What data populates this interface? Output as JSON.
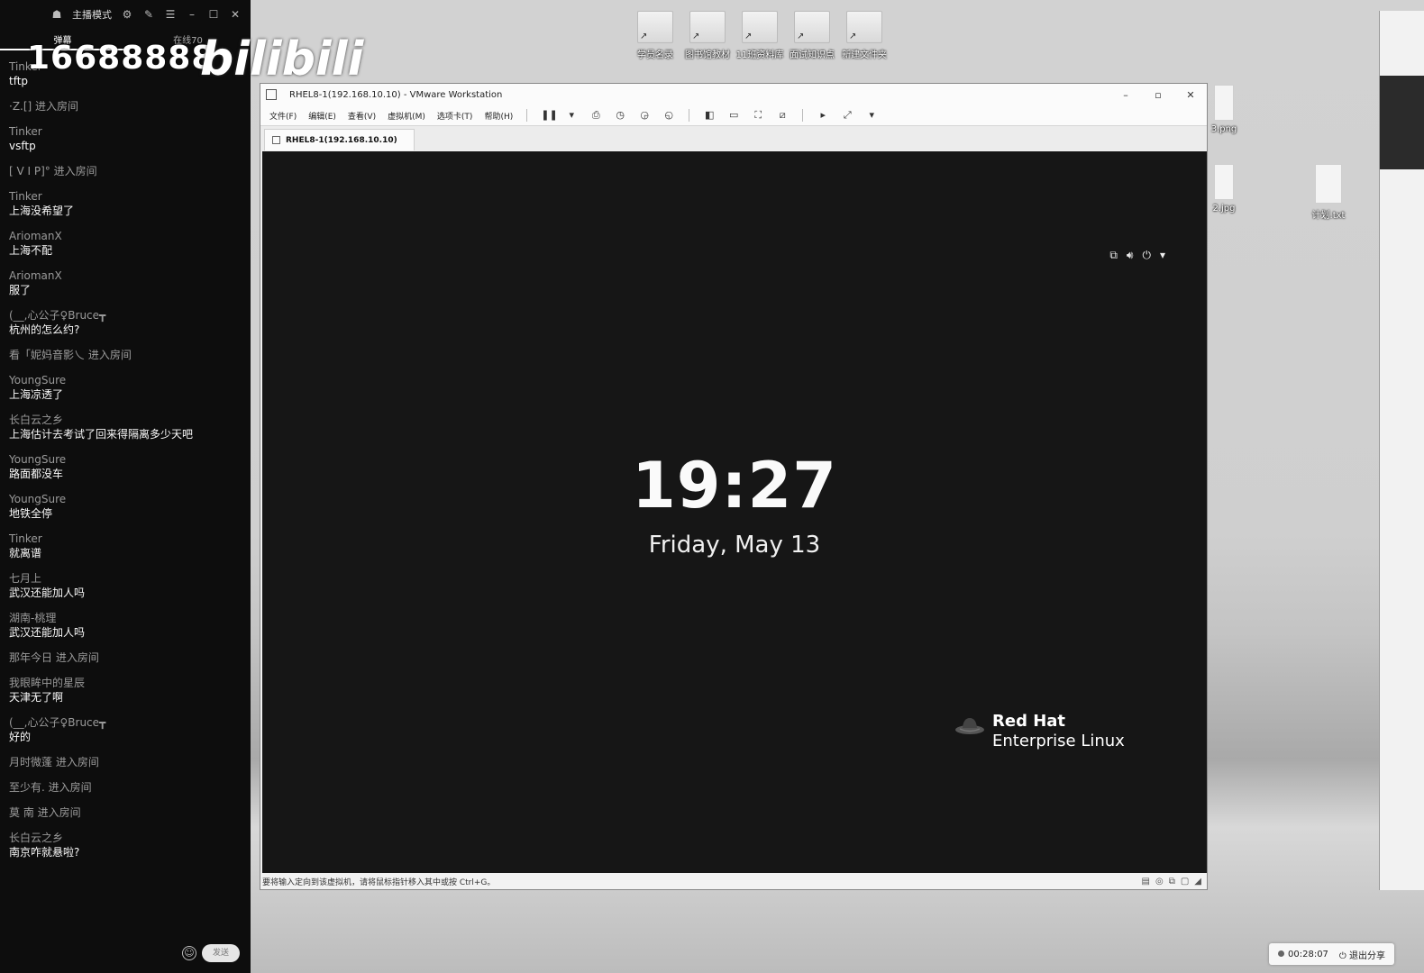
{
  "chat_panel": {
    "mode_label": "主播模式",
    "tabs": [
      "弹幕",
      "在线70"
    ],
    "watermark_number": "16688888",
    "watermark_logo": "bilibili",
    "messages": [
      {
        "user": "Tinker",
        "text": "tftp",
        "type": "chat"
      },
      {
        "user": "",
        "text": "·Z.[] 进入房间",
        "type": "enter"
      },
      {
        "user": "Tinker",
        "text": "vsftp",
        "type": "chat"
      },
      {
        "user": "",
        "text": "[ V I P]° 进入房间",
        "type": "enter"
      },
      {
        "user": "Tinker",
        "text": "上海没希望了",
        "type": "chat"
      },
      {
        "user": "AriomanX",
        "text": "上海不配",
        "type": "chat"
      },
      {
        "user": "AriomanX",
        "text": "服了",
        "type": "chat"
      },
      {
        "user": "(__,心公子♀Bruce┳",
        "text": "杭州的怎么约?",
        "type": "chat"
      },
      {
        "user": "",
        "text": "看「妮妈音影乀 进入房间",
        "type": "enter"
      },
      {
        "user": "YoungSure",
        "text": "上海凉透了",
        "type": "chat"
      },
      {
        "user": "长白云之乡",
        "text": "上海估计去考试了回来得隔离多少天吧",
        "type": "chat"
      },
      {
        "user": "YoungSure",
        "text": "路面都没车",
        "type": "chat"
      },
      {
        "user": "YoungSure",
        "text": "地铁全停",
        "type": "chat"
      },
      {
        "user": "Tinker",
        "text": "就离谱",
        "type": "chat"
      },
      {
        "user": "七月上",
        "text": "武汉还能加人吗",
        "type": "chat"
      },
      {
        "user": "湖南-桃理",
        "text": "武汉还能加人吗",
        "type": "chat"
      },
      {
        "user": "",
        "text": "那年今日 进入房间",
        "type": "enter"
      },
      {
        "user": "我眼眸中的星辰",
        "text": "天津无了啊",
        "type": "chat"
      },
      {
        "user": "(__,心公子♀Bruce┳",
        "text": "好的",
        "type": "chat"
      },
      {
        "user": "",
        "text": "月时微蓬 进入房间",
        "type": "enter"
      },
      {
        "user": "",
        "text": "至少有. 进入房间",
        "type": "enter"
      },
      {
        "user": "",
        "text": "莫 南 进入房间",
        "type": "enter"
      },
      {
        "user": "长白云之乡",
        "text": "南京咋就悬啦?",
        "type": "chat"
      }
    ],
    "send_label": "发送"
  },
  "desktop": {
    "shortcuts": [
      "学员名录",
      "图书馆教材",
      "11班资料库",
      "面试知识点",
      "新建文件夹"
    ],
    "files": [
      "3.png",
      "2.jpg",
      "计划.txt"
    ]
  },
  "vmware": {
    "title": "RHEL8-1(192.168.10.10) - VMware Workstation",
    "menu": [
      "文件(F)",
      "编辑(E)",
      "查看(V)",
      "虚拟机(M)",
      "选项卡(T)",
      "帮助(H)"
    ],
    "tab_label": "RHEL8-1(192.168.10.10)",
    "status_message": "要将输入定向到该虚拟机，请将鼠标指针移入其中或按 Ctrl+G。",
    "guest": {
      "time": "19:27",
      "date": "Friday, May 13",
      "brand_line1": "Red Hat",
      "brand_line2": "Enterprise Linux"
    }
  },
  "share_bar": {
    "timer": "00:28:07",
    "exit_label": "退出分享"
  }
}
